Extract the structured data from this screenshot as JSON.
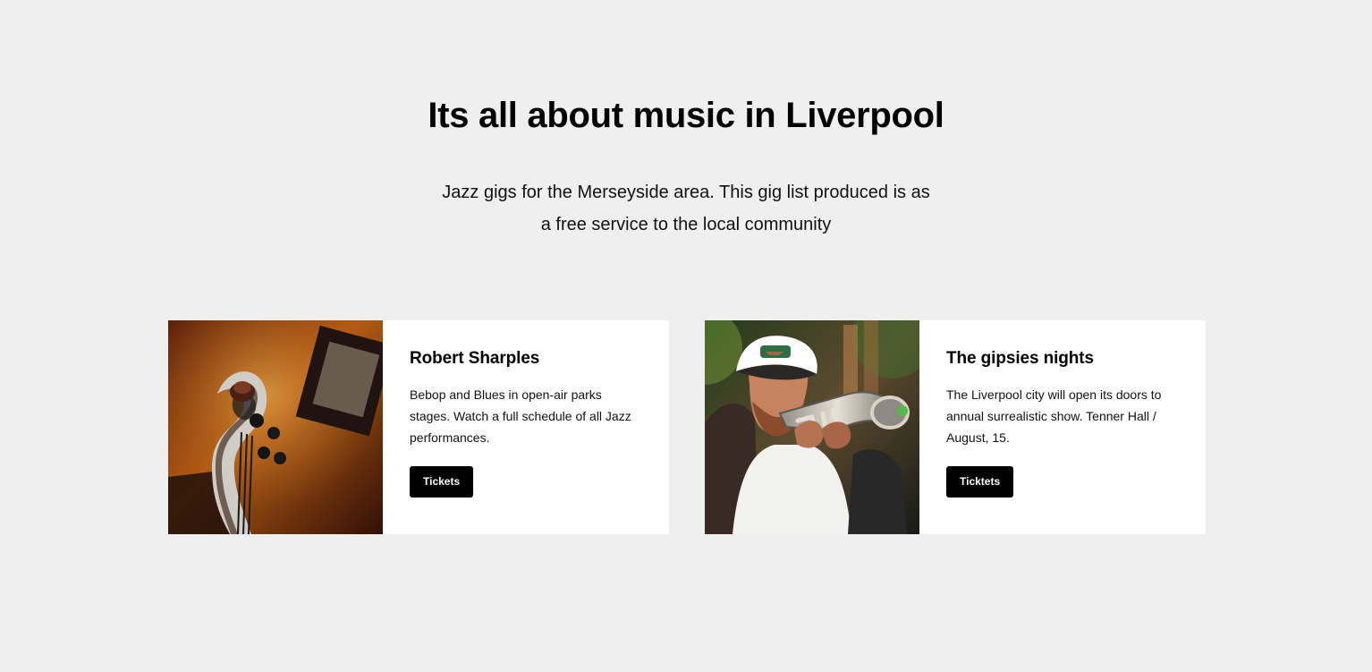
{
  "hero": {
    "title": "Its all about music in Liverpool",
    "subtitle": "Jazz gigs for the Merseyside area. This gig list produced is as a free service to the local community"
  },
  "events": [
    {
      "title": "Robert Sharples",
      "description": "Bebop and Blues in open-air parks stages. Watch a full schedule of all Jazz performances.",
      "button_label": "Tickets"
    },
    {
      "title": "The gipsies nights",
      "description": "The Liverpool city will open its doors to annual surrealistic show. Tenner Hall / August, 15.",
      "button_label": "Ticktets"
    }
  ],
  "colors": {
    "page_background": "#efefef",
    "card_background": "#ffffff",
    "button_background": "#000000",
    "button_text": "#ffffff"
  }
}
